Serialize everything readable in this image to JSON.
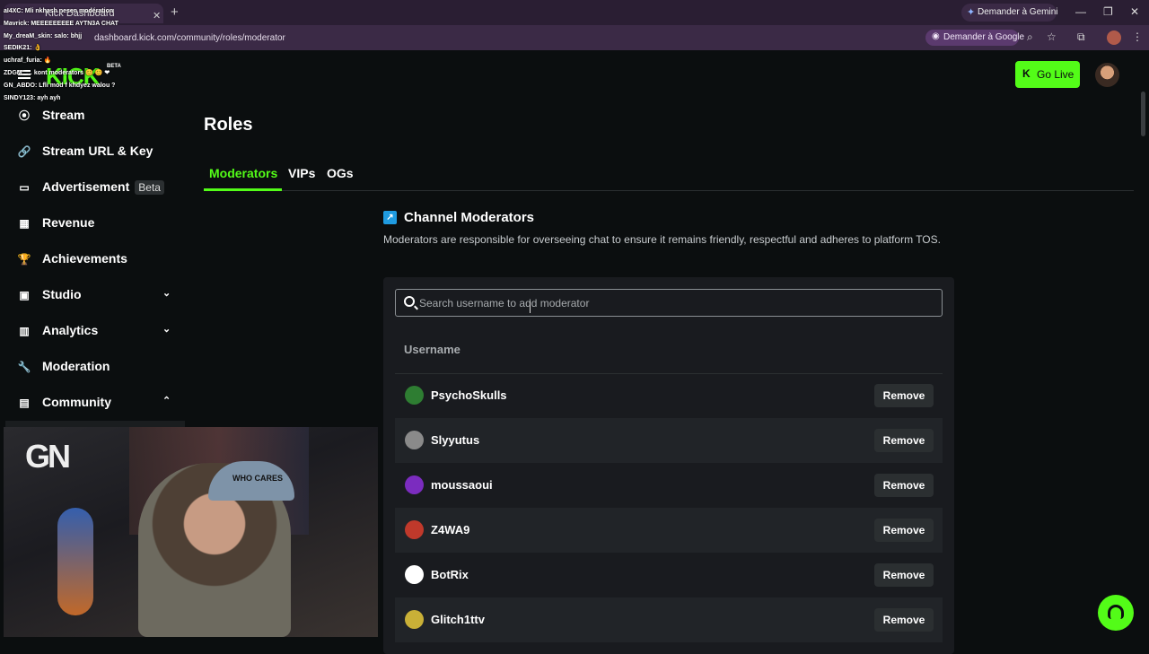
{
  "browser": {
    "tab_title": "Kick Dashboard",
    "tab_close": "✕",
    "new_tab": "+",
    "gemini_label": "Demander à Gemini",
    "url": "dashboard.kick.com/community/roles/moderator",
    "ask_google": "Demander à Google",
    "window_controls": [
      "—",
      "❐",
      "✕"
    ]
  },
  "overlay_chat": {
    "lines": [
      "aI4XC: Mli nkhash nesen modération",
      "Mavrick: MEEEEEEEEE AYTN3A CHAT",
      "My_dreaM_skin: salo: bhjj",
      "SEDIK21: 👌",
      "uchraf_furia: 🔥",
      "ZDGM: … kont moderators 😊 😊 ❤",
      "GN_ABDO: Lfli mod f khdyez walou ?",
      "SINDY123: ayh ayh"
    ]
  },
  "header": {
    "logo": "KICK",
    "logo_badge": "BETA",
    "go_live": "Go Live"
  },
  "sidebar": {
    "items": [
      {
        "label": "Stream",
        "icon": "stream-icon",
        "glyph": "⦿"
      },
      {
        "label": "Stream URL & Key",
        "icon": "link-icon",
        "glyph": "🔗"
      },
      {
        "label": "Advertisement",
        "icon": "ad-icon",
        "glyph": "▭",
        "badge": "Beta"
      },
      {
        "label": "Revenue",
        "icon": "revenue-icon",
        "glyph": "▦"
      },
      {
        "label": "Achievements",
        "icon": "trophy-icon",
        "glyph": "🏆"
      },
      {
        "label": "Studio",
        "icon": "studio-icon",
        "glyph": "▣",
        "chevron": "⌄"
      },
      {
        "label": "Analytics",
        "icon": "analytics-icon",
        "glyph": "▥",
        "chevron": "⌄"
      },
      {
        "label": "Moderation",
        "icon": "wrench-icon",
        "glyph": "🔧"
      },
      {
        "label": "Community",
        "icon": "community-icon",
        "glyph": "▤",
        "chevron": "⌃"
      }
    ]
  },
  "main": {
    "title": "Roles",
    "tabs": [
      "Moderators",
      "VIPs",
      "OGs"
    ],
    "section_title": "Channel Moderators",
    "section_desc": "Moderators are responsible for overseeing chat to ensure it remains friendly, respectful and adheres to platform TOS.",
    "search_placeholder": "Search username to add moderator",
    "column_header": "Username",
    "remove_label": "Remove",
    "moderators": [
      {
        "name": "PsychoSkulls",
        "color": "#2e7d32"
      },
      {
        "name": "Slyyutus",
        "color": "#8a8a8a"
      },
      {
        "name": "moussaoui",
        "color": "#7b2cbf"
      },
      {
        "name": "Z4WA9",
        "color": "#c0392b"
      },
      {
        "name": "BotRix",
        "color": "#ffffff"
      },
      {
        "name": "Glitch1ttv",
        "color": "#c9b037"
      }
    ]
  },
  "webcam": {
    "overlay_logo": "GN",
    "cap_text": "WHO CARES"
  },
  "colors": {
    "accent": "#53fc18",
    "background": "#0b0e0f",
    "panel": "#191b1f"
  }
}
